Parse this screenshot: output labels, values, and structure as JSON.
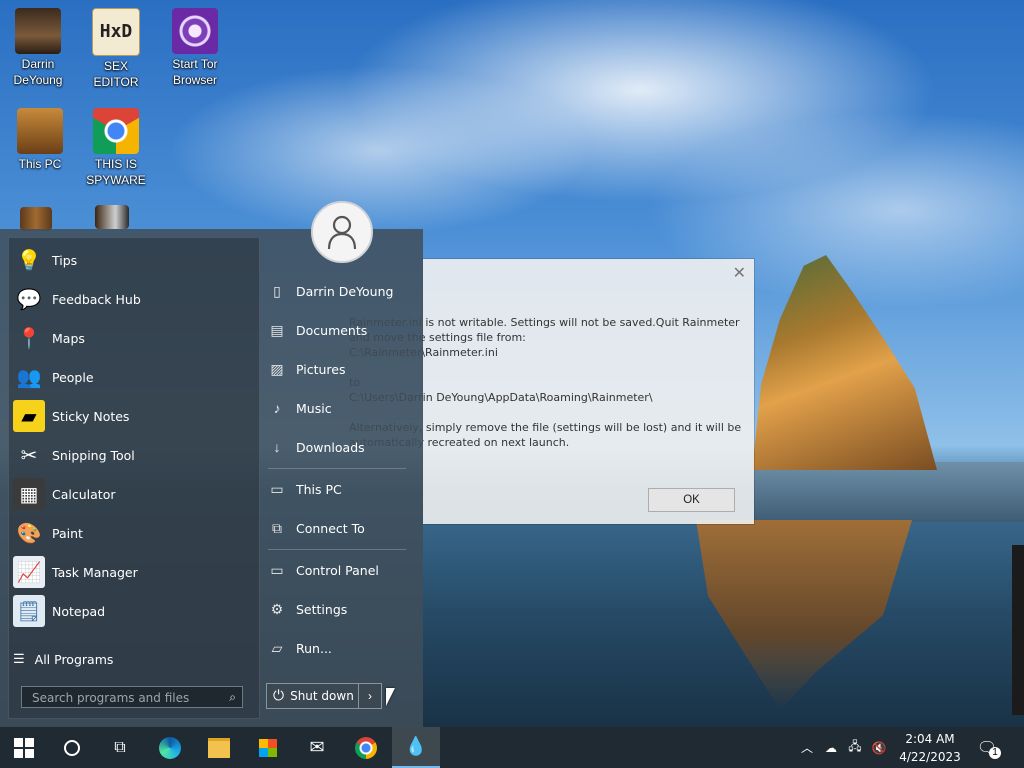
{
  "desktop": {
    "icons": [
      {
        "label": "Darrin\nDeYoung"
      },
      {
        "label": "SEX\nEDITOR"
      },
      {
        "label": "Start Tor\nBrowser"
      },
      {
        "label": "This PC"
      },
      {
        "label": "THIS IS\nSPYWARE"
      }
    ],
    "hxd_glyph": "HxD"
  },
  "start_menu": {
    "programs": [
      {
        "label": "Tips",
        "icon": "lightbulb-icon"
      },
      {
        "label": "Feedback Hub",
        "icon": "feedback-icon"
      },
      {
        "label": "Maps",
        "icon": "maps-icon"
      },
      {
        "label": "People",
        "icon": "people-icon"
      },
      {
        "label": "Sticky Notes",
        "icon": "sticky-notes-icon"
      },
      {
        "label": "Snipping Tool",
        "icon": "snipping-tool-icon"
      },
      {
        "label": "Calculator",
        "icon": "calculator-icon"
      },
      {
        "label": "Paint",
        "icon": "paint-icon"
      },
      {
        "label": "Task Manager",
        "icon": "task-manager-icon"
      },
      {
        "label": "Notepad",
        "icon": "notepad-icon"
      }
    ],
    "all_programs": "All Programs",
    "search_placeholder": "Search programs and files",
    "right_items": [
      {
        "label": "Darrin DeYoung",
        "icon": "user-folder-icon"
      },
      {
        "label": "Documents",
        "icon": "documents-icon"
      },
      {
        "label": "Pictures",
        "icon": "pictures-icon"
      },
      {
        "label": "Music",
        "icon": "music-icon"
      },
      {
        "label": "Downloads",
        "icon": "downloads-icon"
      },
      {
        "label": "This PC",
        "icon": "computer-icon"
      },
      {
        "label": "Connect To",
        "icon": "connect-icon"
      },
      {
        "label": "Control Panel",
        "icon": "control-panel-icon"
      },
      {
        "label": "Settings",
        "icon": "gear-icon"
      },
      {
        "label": "Run...",
        "icon": "run-icon"
      }
    ],
    "shutdown_label": "Shut down"
  },
  "dialog": {
    "message": "Rainmeter.ini is not writable. Settings will not be saved.Quit Rainmeter\nand move the settings file from:\nC:\\Rainmeter\\Rainmeter.ini\n\nto\nC:\\Users\\Darrin DeYoung\\AppData\\Roaming\\Rainmeter\\\n\nAlternatively, simply remove the file (settings will be lost) and it will be\nautomatically recreated on next launch.",
    "ok_label": "OK",
    "close_glyph": "✕"
  },
  "taskbar": {
    "time": "2:04 AM",
    "date": "4/22/2023",
    "notification_count": "1"
  }
}
